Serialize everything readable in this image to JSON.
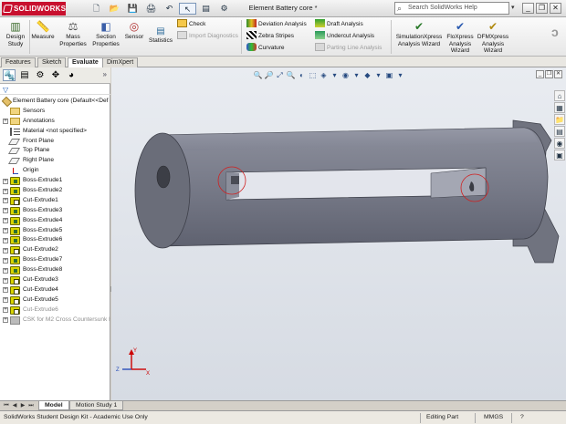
{
  "app": {
    "brand": "SOLIDWORKS",
    "document_title": "Element Battery core *",
    "search_placeholder": "Search SolidWorks Help",
    "search_drop": "▾",
    "window_buttons": [
      "_",
      "❐",
      "✕"
    ]
  },
  "quick_access": [
    "🗋",
    "📂",
    "💾",
    "🖨",
    "↶",
    "↖",
    "▤",
    "⚙"
  ],
  "ribbon": {
    "design_study": "Design Study",
    "measure": "Measure",
    "mass_properties": "Mass Properties",
    "section_properties": "Section Properties",
    "sensor": "Sensor",
    "statistics": "Statistics",
    "check": "Check",
    "import_diagnostics": "Import Diagnostics",
    "deviation_analysis": "Deviation Analysis",
    "zebra_stripes": "Zebra Stripes",
    "curvature": "Curvature",
    "draft_analysis": "Draft Analysis",
    "undercut_analysis": "Undercut Analysis",
    "parting_line_analysis": "Parting Line Analysis",
    "simulationxpress": "SimulationXpress Analysis Wizard",
    "floxpress": "FloXpress Analysis Wizard",
    "dfmxpress": "DFMXpress Analysis Wizard"
  },
  "tabs": [
    "Features",
    "Sketch",
    "Evaluate",
    "DimXpert"
  ],
  "active_tab": "Evaluate",
  "manager_more": "»",
  "tree": {
    "root": "Element Battery core  (Default<<Def",
    "items": [
      {
        "label": "Sensors",
        "icon": "folder"
      },
      {
        "label": "Annotations",
        "icon": "folder",
        "expand": "+"
      },
      {
        "label": "Material <not specified>",
        "icon": "material"
      },
      {
        "label": "Front Plane",
        "icon": "plane"
      },
      {
        "label": "Top Plane",
        "icon": "plane"
      },
      {
        "label": "Right Plane",
        "icon": "plane"
      },
      {
        "label": "Origin",
        "icon": "origin"
      },
      {
        "label": "Boss-Extrude1",
        "icon": "extrude",
        "expand": "+"
      },
      {
        "label": "Boss-Extrude2",
        "icon": "extrude",
        "expand": "+"
      },
      {
        "label": "Cut-Extrude1",
        "icon": "cut",
        "expand": "+"
      },
      {
        "label": "Boss-Extrude3",
        "icon": "extrude",
        "expand": "+"
      },
      {
        "label": "Boss-Extrude4",
        "icon": "extrude",
        "expand": "+"
      },
      {
        "label": "Boss-Extrude5",
        "icon": "extrude",
        "expand": "+"
      },
      {
        "label": "Boss-Extrude6",
        "icon": "extrude",
        "expand": "+"
      },
      {
        "label": "Cut-Extrude2",
        "icon": "cut",
        "expand": "+"
      },
      {
        "label": "Boss-Extrude7",
        "icon": "extrude",
        "expand": "+"
      },
      {
        "label": "Boss-Extrude8",
        "icon": "extrude",
        "expand": "+"
      },
      {
        "label": "Cut-Extrude3",
        "icon": "cut",
        "expand": "+"
      },
      {
        "label": "Cut-Extrude4",
        "icon": "cut",
        "expand": "+"
      },
      {
        "label": "Cut-Extrude5",
        "icon": "cut",
        "expand": "+"
      },
      {
        "label": "Cut-Extrude6",
        "icon": "cut",
        "expand": "+",
        "grey": true
      },
      {
        "label": "CSK for M2 Cross Countersunk H",
        "icon": "hole",
        "expand": "+",
        "grey": true
      }
    ]
  },
  "viewport": {
    "hud_icons": [
      "🔍",
      "🔎",
      "⤢",
      "🔍",
      "◐",
      "⬚",
      "◈",
      "▾",
      "◉",
      "▾",
      "◆",
      "▾",
      "▣",
      "▾"
    ],
    "view_buttons": [
      "_",
      "❐",
      "✕"
    ],
    "taskpane_icons": [
      "⌂",
      "▦",
      "📁",
      "▤",
      "◉",
      "▣"
    ],
    "triad": {
      "x": "X",
      "y": "Y",
      "z": "Z"
    },
    "colors": {
      "part": "#7a7d8c",
      "highlight": "#e0e0e8",
      "callout": "#d02020"
    }
  },
  "bottom_tabs": [
    "Model",
    "Motion Study 1"
  ],
  "status": {
    "license": "SolidWorks Student Design Kit - Academic Use Only",
    "mode": "Editing Part",
    "units": "MMGS",
    "help": "?"
  }
}
